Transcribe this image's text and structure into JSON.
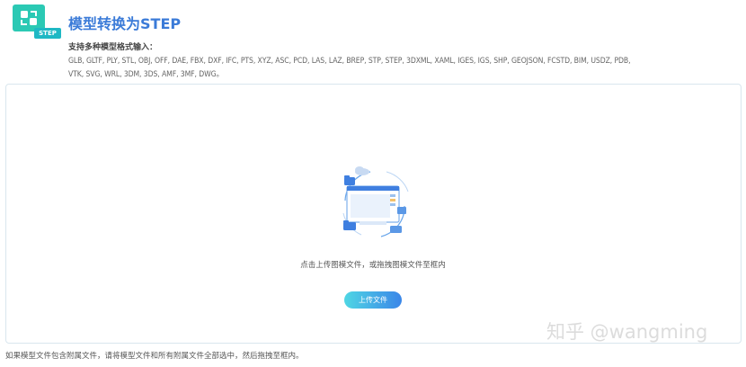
{
  "header": {
    "logo_tag": "STEP",
    "title": "模型转换为STEP",
    "formats_label": "支持多种模型格式输入：",
    "formats_line1": "GLB, GLTF, PLY, STL, OBJ, OFF, DAE, FBX, DXF, IFC, PTS, XYZ, ASC, PCD, LAS, LAZ, BREP, STP, STEP, 3DXML, XAML, IGES, IGS, SHP, GEOJSON, FCSTD, BIM, USDZ, PDB,",
    "formats_line2": "VTK, SVG, WRL, 3DM, 3DS, AMF, 3MF, DWG。"
  },
  "dropzone": {
    "illustration_icon": "upload-files-illustration",
    "hint": "点击上传图模文件，或拖拽图模文件至框内",
    "upload_button": "上传文件"
  },
  "footnote": "如果模型文件包含附属文件，请将模型文件和所有附属文件全部选中，然后拖拽至框内。",
  "watermark": "知乎 @wangming",
  "colors": {
    "accent_teal": "#2bc9b4",
    "title_blue": "#3b7bd8",
    "button_gradient_start": "#4fd6e4",
    "button_gradient_end": "#3a86e8"
  }
}
